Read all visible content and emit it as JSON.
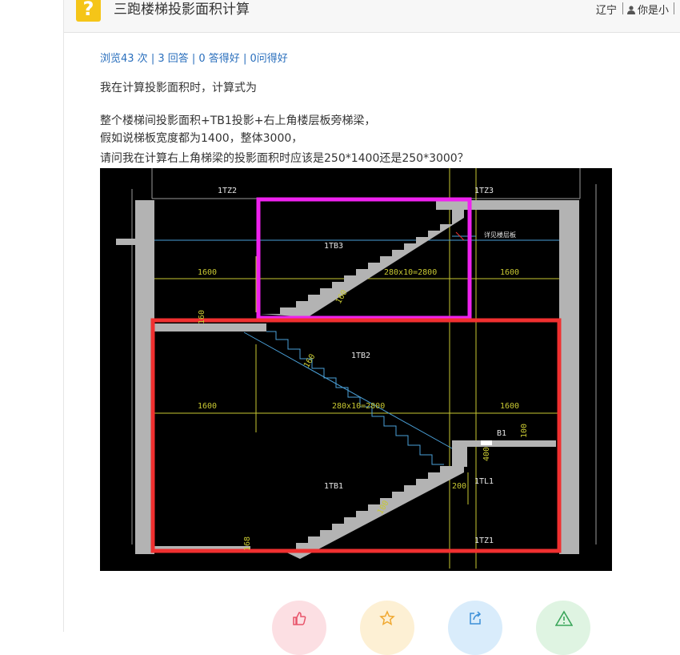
{
  "header": {
    "question_mark": "?",
    "title": "三跑楼梯投影面积计算",
    "region": "辽宁",
    "user": "你是小"
  },
  "stats": {
    "views": "浏览43 次",
    "answers": "3 回答",
    "good_answers": "0 答得好",
    "good_questions": "0问得好",
    "separator": " | "
  },
  "question": {
    "intro": "我在计算投影面积时，计算式为",
    "line1": "整个楼梯间投影面积+TB1投影+右上角楼层板旁梯梁，",
    "line2": "假如说梯板宽度都为1400，整体3000，",
    "line3": "请问我在计算右上角梯梁的投影面积时应该是250*1400还是250*3000？"
  },
  "drawing": {
    "labels": {
      "tz2": "1TZ2",
      "tz3": "1TZ3",
      "tb3": "1TB3",
      "tb2": "1TB2",
      "tb1": "1TB1",
      "b1": "B1",
      "tl1": "1TL1",
      "tz1": "1TZ1",
      "dim_left_1": "1600",
      "dim_left_2": "1600",
      "dim_right_1": "1600",
      "dim_right_2": "1600",
      "dim_mid_1": "280x10=2800",
      "dim_mid_2": "280x10=2800",
      "d160a": "160",
      "d160b": "160",
      "d160c": "160",
      "d100a": "100",
      "d100b": "100",
      "d400": "400",
      "d200": "200",
      "d168": "168",
      "floor_note": "详见楼层板"
    },
    "colors": {
      "magenta": "#ee22ee",
      "red": "#f03030",
      "wall": "#b3b3b3",
      "dim_line": "#c8c832",
      "leader": "#4aa0d8"
    }
  },
  "actions": [
    {
      "name": "like",
      "icon": "thumbs-up-icon",
      "bg": "#fcdfe3",
      "color": "#e8546a"
    },
    {
      "name": "favorite",
      "icon": "star-icon",
      "bg": "#fdf0d4",
      "color": "#f0a830"
    },
    {
      "name": "share",
      "icon": "share-icon",
      "bg": "#d9ecfb",
      "color": "#3b8fd8"
    },
    {
      "name": "report",
      "icon": "warning-icon",
      "bg": "#dff4e2",
      "color": "#3aa55a"
    }
  ]
}
